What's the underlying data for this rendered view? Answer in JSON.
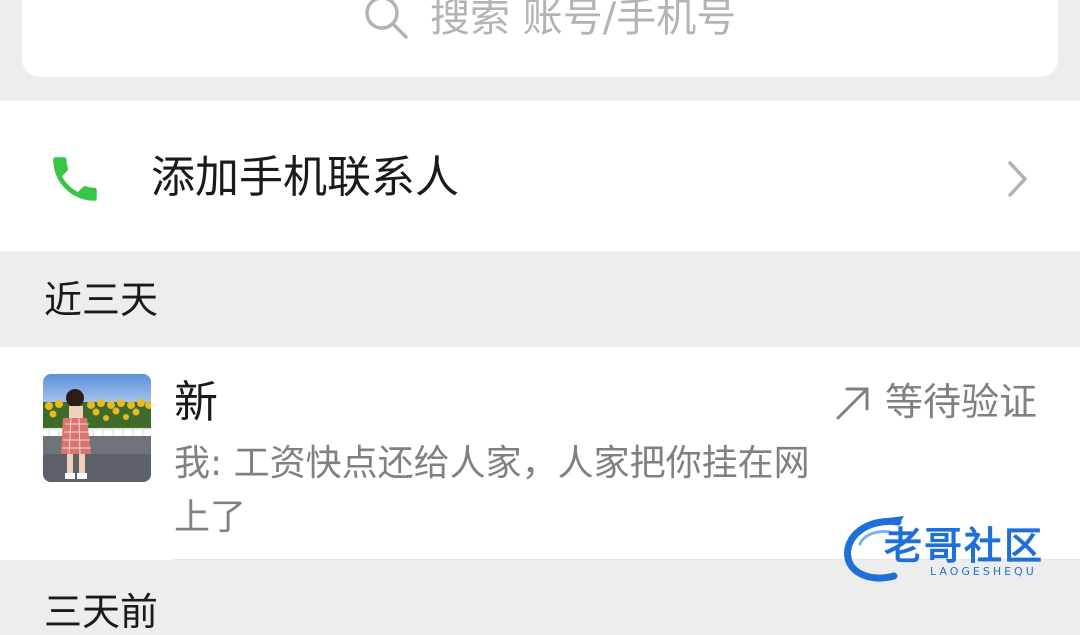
{
  "search": {
    "icon": "search-icon",
    "placeholder": "搜索 账号/手机号"
  },
  "phone_contacts": {
    "icon": "phone-icon",
    "label": "添加手机联系人",
    "chevron_icon": "chevron-right-icon",
    "icon_color": "#39c545"
  },
  "sections": [
    {
      "title": "近三天",
      "requests": [
        {
          "name": "新",
          "message": "我: 工资快点还给人家，人家把你挂在网上了",
          "status": "等待验证",
          "status_icon": "arrow-up-right-icon",
          "avatar": "avatar-photo"
        }
      ]
    },
    {
      "title": "三天前"
    }
  ],
  "watermark": {
    "text": "老哥社区",
    "sub": "LAOGESHEQU",
    "color": "#1e6fd9"
  },
  "colors": {
    "background": "#ededed",
    "card": "#ffffff",
    "secondary_text": "#808080",
    "placeholder_text": "#b3b3b3"
  }
}
